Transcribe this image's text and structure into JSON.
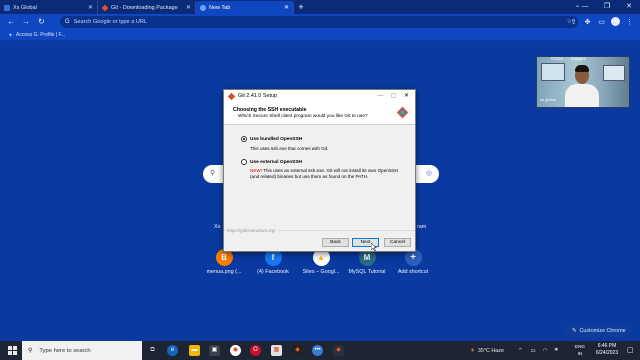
{
  "browser": {
    "tabs": [
      {
        "label": "Xs Global",
        "favicon_color": "#3a6fd8"
      },
      {
        "label": "Git - Downloading Package",
        "favicon_color": "#e44c30"
      },
      {
        "label": "New Tab",
        "favicon_color": "#6fa0ff"
      }
    ],
    "omnibox_placeholder": "Search Google or type a URL",
    "bookmark": "Access G. Profile | F..."
  },
  "ntp": {
    "links": [
      "Gmail",
      "Images"
    ],
    "shortcuts": [
      {
        "label": "menua.png (...",
        "icon": "blogger-icon",
        "glyph": "B",
        "color": "#f57d00"
      },
      {
        "label": "(4) Facebook",
        "icon": "facebook-icon",
        "glyph": "f",
        "color": "#1877f2"
      },
      {
        "label": "Sites – Googl...",
        "icon": "google-ads-icon",
        "glyph": "▲",
        "color": "#fbbc04"
      },
      {
        "label": "MySQL Tutorial",
        "icon": "mysql-icon",
        "glyph": "M",
        "color": "#2a6a83"
      },
      {
        "label": "Add shortcut",
        "icon": "plus-icon",
        "glyph": "+",
        "color": "#2b5fbf"
      }
    ],
    "partial_left": "Xs",
    "partial_right": "ram",
    "customize": "Customize Chrome"
  },
  "webcam": {
    "overlay_left": "Gmail",
    "overlay_right": "Images",
    "tag": "xs global"
  },
  "dialog": {
    "title": "Git 2.41.0 Setup",
    "heading": "Choosing the SSH executable",
    "subheading": "Which Secure Shell client program would you like Git to use?",
    "option1_label": "Use bundled OpenSSH",
    "option1_desc": "This uses ssh.exe that comes with Git.",
    "option2_label": "Use external OpenSSH",
    "option2_new": "NEW!",
    "option2_desc": " This uses an external ssh.exe. Git will not install its own OpenSSH (and related) binaries but use them as found on the PATH.",
    "url": "https://gitforwindows.org/",
    "back": "Back",
    "next": "Next",
    "cancel": "Cancel",
    "selected_option": 1
  },
  "taskbar": {
    "search_placeholder": "Type here to search",
    "weather": "35°C Haze",
    "lang_top": "ENG",
    "lang_bottom": "IN",
    "time": "6:46 PM",
    "date": "6/24/2023"
  }
}
